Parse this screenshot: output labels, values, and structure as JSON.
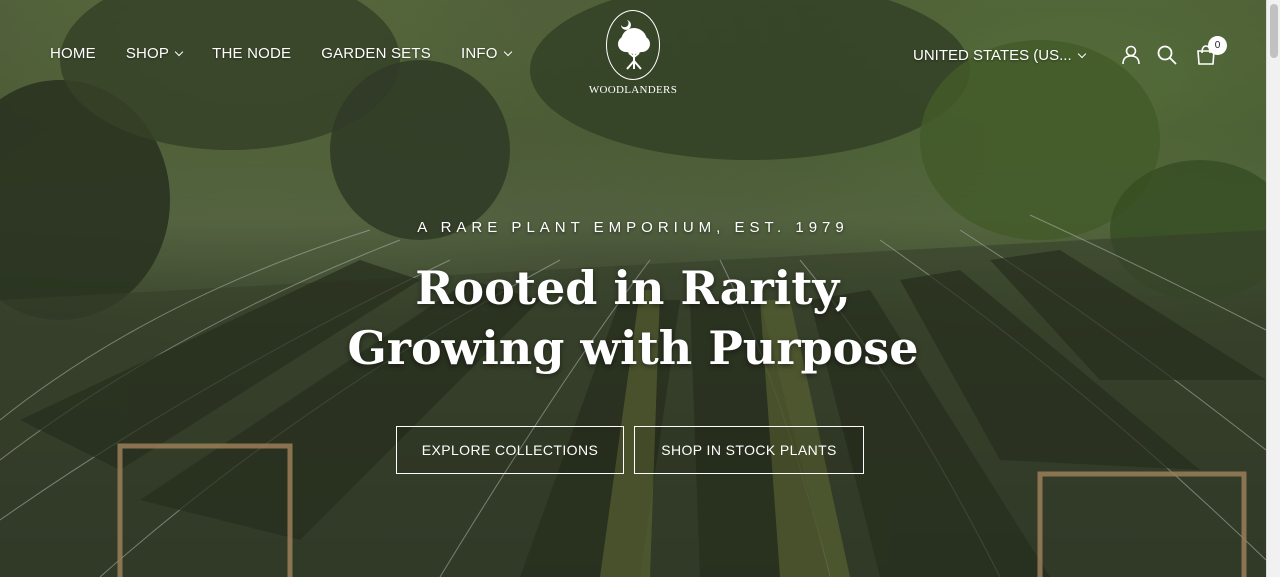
{
  "nav": {
    "items": [
      {
        "label": "HOME",
        "dropdown": false
      },
      {
        "label": "SHOP",
        "dropdown": true
      },
      {
        "label": "THE NODE",
        "dropdown": false
      },
      {
        "label": "GARDEN SETS",
        "dropdown": false
      },
      {
        "label": "INFO",
        "dropdown": true
      }
    ]
  },
  "logo": {
    "text": "WOODLANDERS",
    "icon": "tree-logo-icon"
  },
  "header": {
    "region": "UNITED STATES (US...",
    "account_icon": "user-icon",
    "search_icon": "search-icon",
    "cart_icon": "shopping-bag-icon",
    "cart_count": "0"
  },
  "hero": {
    "eyebrow": "A RARE PLANT EMPORIUM, EST. 1979",
    "headline": "Rooted in Rarity, Growing with Purpose",
    "primary_cta": "EXPLORE COLLECTIONS",
    "secondary_cta": "SHOP IN STOCK PLANTS"
  },
  "colors": {
    "text": "#ffffff",
    "badge_bg": "#ffffff"
  }
}
